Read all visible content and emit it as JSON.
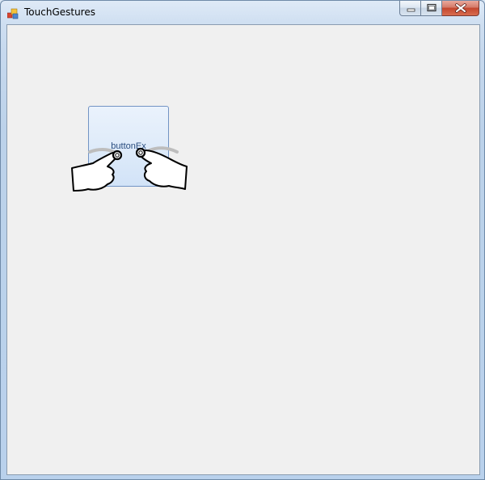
{
  "window": {
    "title": "TouchGestures"
  },
  "icons": {
    "app": "app-icon",
    "minimize": "minimize-icon",
    "maximize": "maximize-icon",
    "close": "close-icon",
    "gesture": "two-finger-pinch-gesture-icon"
  },
  "button": {
    "label": "buttonEx"
  },
  "colors": {
    "client_background": "#f0f0f0",
    "button_border": "#7294c4",
    "close_button": "#c3462e"
  }
}
